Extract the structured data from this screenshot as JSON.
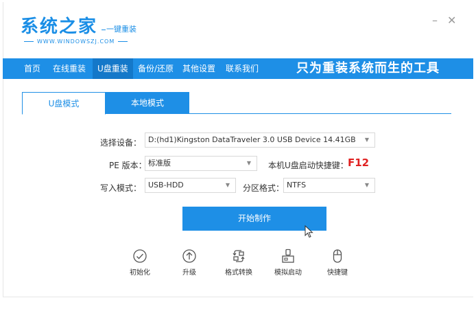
{
  "brand": {
    "title": "系统之家",
    "subtitle": "一键重装",
    "url": "WWW.WINDOWSZJ.COM"
  },
  "window_controls": {
    "minimize": "–",
    "close": "✕"
  },
  "nav": {
    "items": [
      "首页",
      "在线重装",
      "U盘重装",
      "备份/还原",
      "其他设置",
      "联系我们"
    ],
    "active": "U盘重装",
    "slogan": "只为重装系统而生的工具"
  },
  "tabs": [
    "U盘模式",
    "本地模式"
  ],
  "form": {
    "device_label": "选择设备：",
    "device_value": "D:(hd1)Kingston DataTraveler 3.0 USB Device 14.41GB",
    "pe_label": "PE 版本：",
    "pe_value": "标准版",
    "hotkey_label": "本机U盘启动快捷键：",
    "hotkey_value": "F12",
    "write_label": "写入模式：",
    "write_value": "USB-HDD",
    "partition_label": "分区格式：",
    "partition_value": "NTFS",
    "arrow": "▼"
  },
  "start_button": "开始制作",
  "tools": [
    {
      "label": "初始化",
      "icon": "check-circle-icon"
    },
    {
      "label": "升级",
      "icon": "upgrade-arrow-icon"
    },
    {
      "label": "格式转换",
      "icon": "format-convert-icon"
    },
    {
      "label": "模拟启动",
      "icon": "simulate-boot-icon"
    },
    {
      "label": "快捷键",
      "icon": "mouse-icon"
    }
  ],
  "colors": {
    "accent": "#1e8fe6",
    "nav_active": "#1478c9",
    "hotkey": "#e02020"
  }
}
